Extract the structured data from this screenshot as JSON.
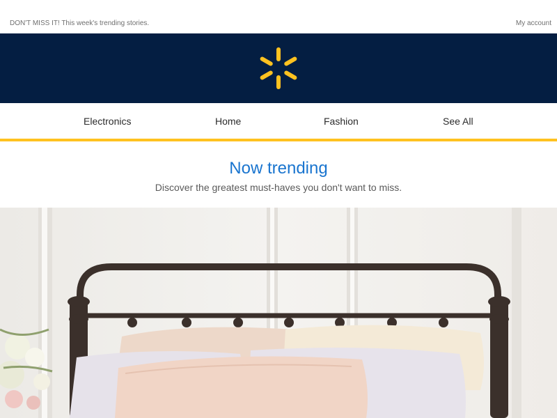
{
  "header": {
    "promo_text": "DON'T MISS IT! This week's trending stories.",
    "account_link": "My account"
  },
  "brand": {
    "logo_icon": "spark-icon",
    "bar_color": "#041e42",
    "spark_color": "#ffc220"
  },
  "nav": {
    "items": [
      {
        "label": "Electronics"
      },
      {
        "label": "Home"
      },
      {
        "label": "Fashion"
      },
      {
        "label": "See All"
      }
    ],
    "underline_color": "#ffc220"
  },
  "intro": {
    "title": "Now trending",
    "subtitle": "Discover the greatest must-haves you don't want to miss."
  },
  "hero": {
    "image_subject": "bed-with-metal-headboard-and-pillows"
  }
}
